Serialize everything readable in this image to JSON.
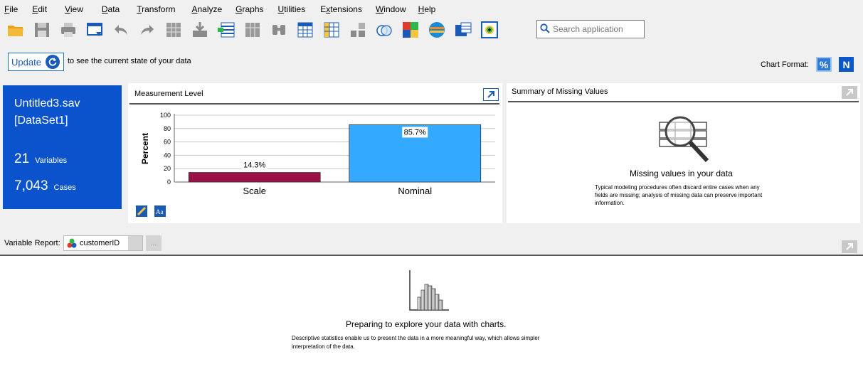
{
  "menu": [
    "File",
    "Edit",
    "View",
    "Data",
    "Transform",
    "Analyze",
    "Graphs",
    "Utilities",
    "Extensions",
    "Window",
    "Help"
  ],
  "menu_mnemonic": [
    "F",
    "E",
    "V",
    "D",
    "T",
    "A",
    "G",
    "U",
    "x",
    "W",
    "H"
  ],
  "search": {
    "placeholder": "Search application"
  },
  "update": {
    "label": "Update",
    "text": "to see the current state of your data"
  },
  "chart_format": {
    "label": "Chart Format:",
    "percent_label": "%",
    "count_label": "N"
  },
  "dataset": {
    "file": "Untitled3.sav",
    "name": "[DataSet1]",
    "variables_count": "21",
    "variables_label": "Variables",
    "cases_count": "7,043",
    "cases_label": "Cases"
  },
  "measurement_panel": {
    "title": "Measurement Level"
  },
  "missing_panel": {
    "title": "Summary of Missing Values",
    "heading": "Missing values in your data",
    "description": "Typical modeling procedures often discard entire cases when any fields are missing; analysis of missing data can preserve important information."
  },
  "variable_report": {
    "label": "Variable Report:",
    "selected": "customerID",
    "more_label": "..."
  },
  "explore": {
    "heading": "Preparing to explore your data with charts.",
    "description": "Descriptive statistics enable us to present the data in a more meaningful way, which allows simpler interpretation of the data."
  },
  "colors": {
    "scale_bar": "#9b1046",
    "nominal_bar": "#33aaff",
    "card": "#0a53cc",
    "accent": "#1a5bb8"
  },
  "chart_data": {
    "type": "bar",
    "title": "Measurement Level",
    "categories": [
      "Scale",
      "Nominal"
    ],
    "values": [
      14.3,
      85.7
    ],
    "data_labels": [
      "14.3%",
      "85.7%"
    ],
    "ylabel": "Percent",
    "xlabel": "",
    "ylim": [
      0,
      100
    ],
    "yticks": [
      0,
      20,
      40,
      60,
      80,
      100
    ],
    "grid": true,
    "colors": [
      "#9b1046",
      "#33aaff"
    ]
  }
}
